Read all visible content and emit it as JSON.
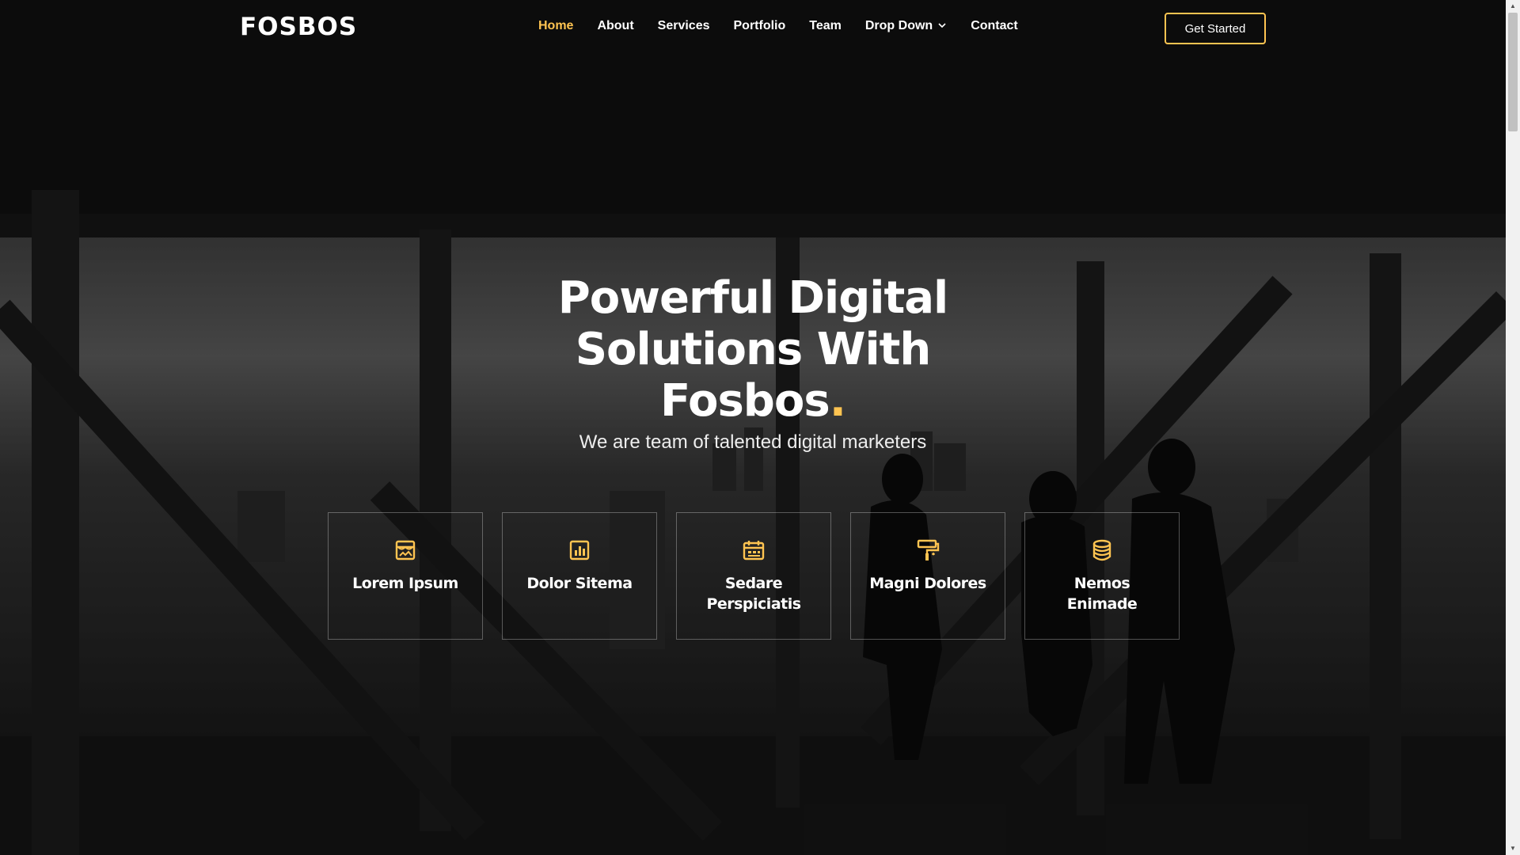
{
  "header": {
    "logo": "FOSBOS",
    "nav": [
      {
        "label": "Home",
        "active": true
      },
      {
        "label": "About"
      },
      {
        "label": "Services"
      },
      {
        "label": "Portfolio"
      },
      {
        "label": "Team"
      },
      {
        "label": "Drop Down",
        "has_dropdown": true
      },
      {
        "label": "Contact"
      }
    ],
    "cta": "Get Started"
  },
  "hero": {
    "title_line1": "Powerful Digital",
    "title_line2": "Solutions With",
    "title_line3": "Fosbos",
    "title_dot": ".",
    "subtitle": "We are team of talented digital marketers"
  },
  "features": [
    {
      "label": "Lorem Ipsum",
      "icon": "store-icon"
    },
    {
      "label": "Dolor Sitema",
      "icon": "bar-chart-icon"
    },
    {
      "label": "Sedare Perspiciatis",
      "icon": "calendar-icon"
    },
    {
      "label": "Magni Dolores",
      "icon": "paint-roller-icon"
    },
    {
      "label": "Nemos Enimade",
      "icon": "database-icon"
    }
  ],
  "colors": {
    "accent": "#ffc451",
    "text": "#ffffff",
    "background": "#0e0e0e"
  }
}
